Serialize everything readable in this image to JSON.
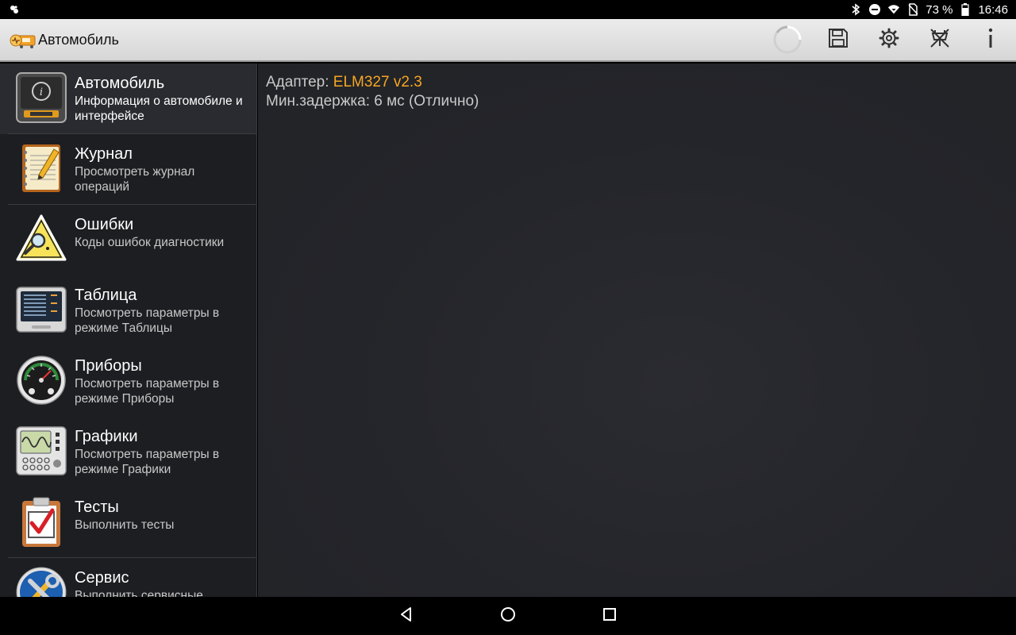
{
  "status_bar": {
    "battery": "73 %",
    "time": "16:46",
    "icons": [
      "notification-icon",
      "bluetooth-icon",
      "do-not-disturb-icon",
      "wifi-icon",
      "no-sim-icon",
      "battery-icon"
    ]
  },
  "action_bar": {
    "title": "Автомобиль",
    "actions": [
      "progress-spinner",
      "save-icon",
      "settings-gear-icon",
      "disconnect-icon",
      "info-icon"
    ]
  },
  "menu": {
    "items": [
      {
        "title": "Автомобиль",
        "subtitle": "Информация о автомобиле и интерфейсе",
        "icon": "car-info-icon"
      },
      {
        "title": "Журнал",
        "subtitle": "Просмотреть журнал операций",
        "icon": "journal-icon"
      },
      {
        "title": "Ошибки",
        "subtitle": "Коды ошибок диагностики",
        "icon": "warning-magnifier-icon"
      },
      {
        "title": "Таблица",
        "subtitle": "Посмотреть параметры в режиме Таблицы",
        "icon": "table-display-icon"
      },
      {
        "title": "Приборы",
        "subtitle": "Посмотреть параметры в режиме Приборы",
        "icon": "gauge-icon"
      },
      {
        "title": "Графики",
        "subtitle": "Посмотреть параметры в режиме Графики",
        "icon": "oscilloscope-icon"
      },
      {
        "title": "Тесты",
        "subtitle": "Выполнить тесты",
        "icon": "clipboard-check-icon"
      },
      {
        "title": "Сервис",
        "subtitle": "Выполнить сервисные",
        "icon": "service-tools-icon"
      }
    ]
  },
  "content": {
    "adapter_label": "Адаптер: ",
    "adapter_value": "ELM327 v2.3",
    "delay_line": "Мин.задержка: 6 мс (Отлично)"
  },
  "colors": {
    "accent": "#f5a623",
    "sidebar_bg": "#1d1e22",
    "content_bg": "#24252a",
    "action_bar_bg": "#e2e2e2"
  }
}
